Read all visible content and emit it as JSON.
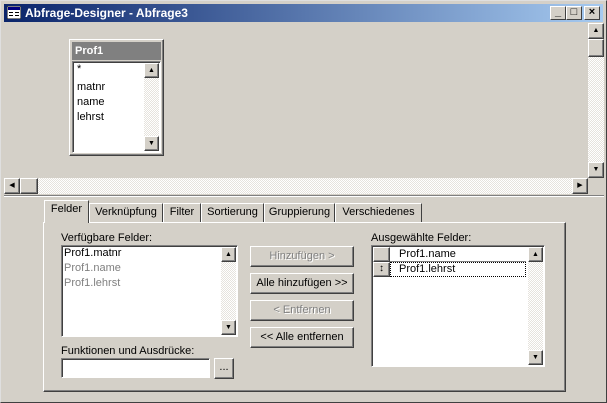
{
  "window": {
    "title": "Abfrage-Designer - Abfrage3",
    "minimize": "_",
    "maximize": "□",
    "close": "×"
  },
  "table_box": {
    "name": "Prof1",
    "fields": [
      "*",
      "matnr",
      "name",
      "lehrst"
    ]
  },
  "tabs": [
    "Felder",
    "Verknüpfung",
    "Filter",
    "Sortierung",
    "Gruppierung",
    "Verschiedenes"
  ],
  "available": {
    "label": "Verfügbare Felder:",
    "items": [
      {
        "text": "Prof1.matnr",
        "disabled": false
      },
      {
        "text": "Prof1.name",
        "disabled": true
      },
      {
        "text": "Prof1.lehrst",
        "disabled": true
      }
    ]
  },
  "buttons": {
    "add": "Hinzufügen >",
    "add_all": "Alle hinzufügen >>",
    "remove": "< Entfernen",
    "remove_all": "<< Alle entfernen"
  },
  "selected": {
    "label": "Ausgewählte Felder:",
    "items": [
      "Prof1.name",
      "Prof1.lehrst"
    ]
  },
  "functions": {
    "label": "Funktionen und Ausdrücke:",
    "value": "",
    "button": "..."
  }
}
